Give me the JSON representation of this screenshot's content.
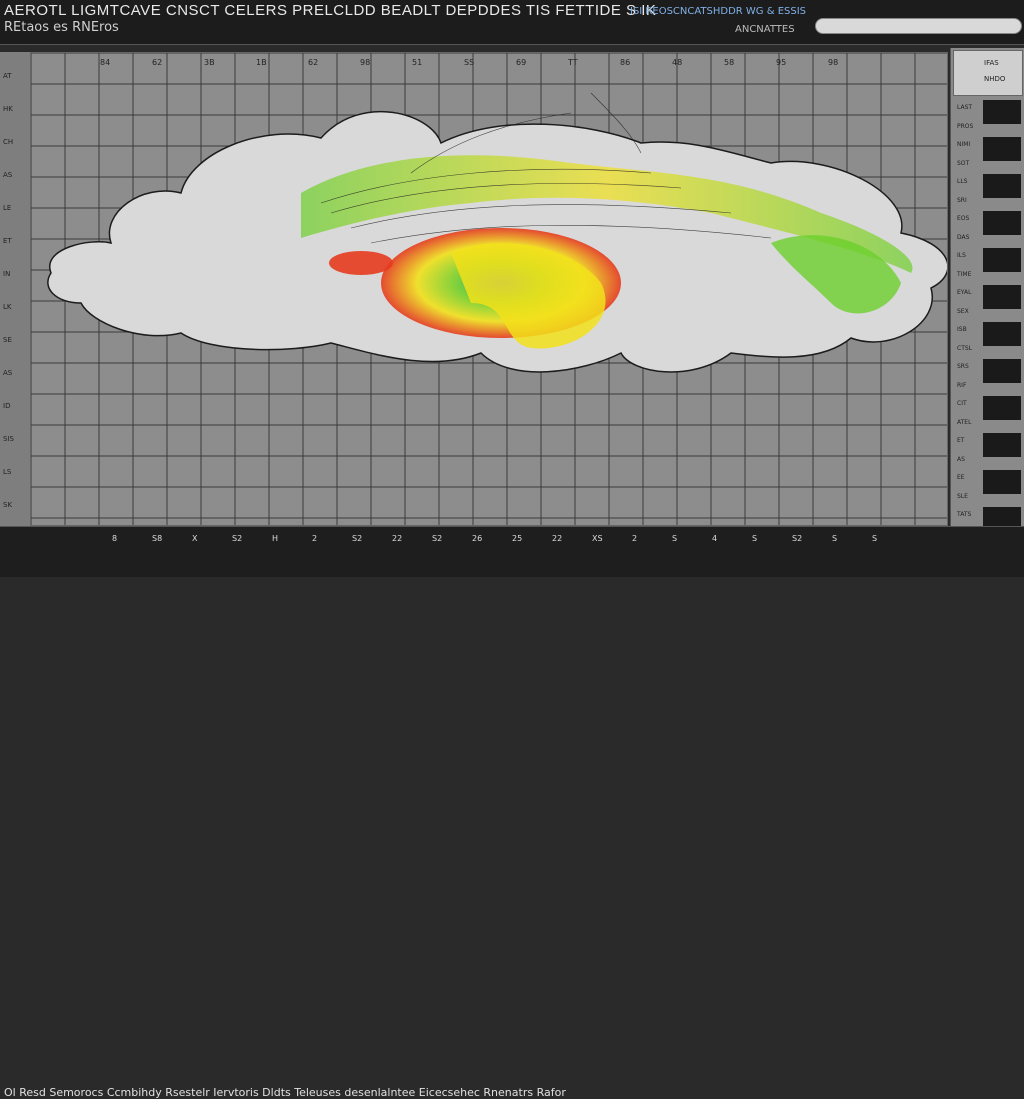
{
  "header": {
    "title": "AEROTL LIGMTCAVE CNSCT CELERS PRELCLDD BEADLT DEPDDES TIS FETTIDE S IK",
    "subtitle": "REtaos es RNEros",
    "right_status": "ISI REOSCNCATSHDDR WG & ESSIS",
    "right_sub": "ANCNATTES"
  },
  "search": {
    "placeholder": ""
  },
  "colors": {
    "background": "#2a2a2a",
    "plot": "#8d8d8d",
    "grid": "#3a3a3a",
    "cloud": "#d9d9d9",
    "red": "#e53b1e",
    "yellow": "#f2e11a",
    "green": "#6ccf2c",
    "blue": "#2f6fd9"
  },
  "left_axis": {
    "ticks": [
      "AT",
      "HK",
      "CH",
      "AS",
      "LE",
      "ET",
      "IN",
      "LK",
      "SE",
      "AS",
      "ID",
      "SIS",
      "LS",
      "SK"
    ]
  },
  "top_ticks": [
    "84",
    "62",
    "3B",
    "1B",
    "62",
    "98",
    "51",
    "SS",
    "69",
    "TT",
    "86",
    "48",
    "58",
    "95",
    "98"
  ],
  "bottom_ticks": [
    "8",
    "S8",
    "X",
    "S2",
    "H",
    "2",
    "S2",
    "22",
    "S2",
    "26",
    "25",
    "22",
    "XS",
    "2",
    "S",
    "4",
    "S",
    "S2",
    "S",
    "S"
  ],
  "right_panel": {
    "header_lines": [
      "IFAS",
      "NHDO"
    ],
    "rows": [
      "LAST",
      "PROS",
      "NIMI",
      "SOT",
      "LLS",
      "SRI",
      "EOS",
      "DAS",
      "ILS",
      "TIME",
      "EYAL",
      "SEX",
      "ISB",
      "CTSL",
      "SRS",
      "RIF",
      "CIT",
      "ATEL",
      "ET",
      "AS",
      "EE",
      "SLE",
      "TATS",
      "IET"
    ]
  },
  "footer": {
    "text": "Ol Resd Semorocs Ccmbihdy Rsestelr Iervtoris Dldts Teleuses desenlalntee Eicecsehec Rnenatrs Rafor"
  }
}
